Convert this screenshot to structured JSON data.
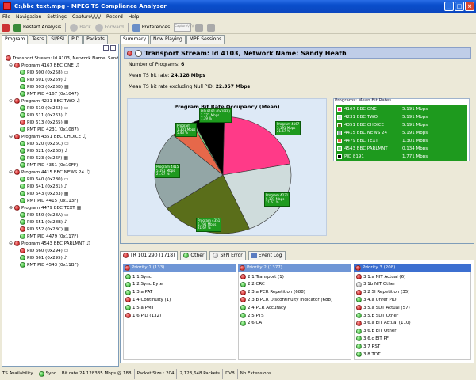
{
  "window": {
    "title": "C:\\bbc_text.mpg - MPEG TS Compliance Analyser"
  },
  "menu": [
    "File",
    "Navigation",
    "Settings",
    "Capture\\/\\/\\/",
    "Record",
    "Help"
  ],
  "toolbar": {
    "restart": "Restart Analysis",
    "back": "Back",
    "forward": "Forward",
    "preferences": "Preferences",
    "capture": "Capture\\/\\/\\/"
  },
  "left_tabs": [
    "Program",
    "Tests",
    "SI/PSI",
    "PID",
    "Packets"
  ],
  "tree": {
    "root": "Transport Stream: Id 4103, Network Name: Sand",
    "programs": [
      {
        "label": "Program 4167 BBC ONE",
        "pids": [
          "PID 600 (0x258)",
          "PID 601 (0x259)",
          "PID 603 (0x25B)",
          "PMT PID 4167 (0x1047)"
        ]
      },
      {
        "label": "Program 4231 BBC TWO",
        "pids": [
          "PID 610 (0x262)",
          "PID 611 (0x263)",
          "PID 613 (0x265)",
          "PMT PID 4231 (0x1087)"
        ]
      },
      {
        "label": "Program 4351 BBC CHOICE",
        "pids": [
          "PID 620 (0x26C)",
          "PID 621 (0x26D)",
          "PID 623 (0x26F)",
          "PMT PID 4351 (0x10FF)"
        ]
      },
      {
        "label": "Program 4415 BBC NEWS 24",
        "pids": [
          "PID 640 (0x280)",
          "PID 641 (0x281)",
          "PID 643 (0x283)",
          "PMT PID 4415 (0x113F)"
        ]
      },
      {
        "label": "Program 4479 BBC TEXT",
        "pids": [
          "PID 650 (0x28A)",
          "PID 651 (0x28B)",
          "PID 652 (0x28C)",
          "PMT PID 4479 (0x117F)"
        ]
      },
      {
        "label": "Program 4543 BBC PARLMNT",
        "pids": [
          "PID 660 (0x294)",
          "PID 661 (0x295)",
          "PMT PID 4543 (0x11BF)"
        ]
      }
    ]
  },
  "right_tabs": [
    "Summary",
    "Now Playing",
    "MPE Sessions"
  ],
  "summary": {
    "header": "Transport Stream: Id 4103, Network Name: Sandy Heath",
    "programs_label": "Number of Programs:",
    "programs_value": "6",
    "bitrate_label": "Mean TS bit rate:",
    "bitrate_value": "24.128 Mbps",
    "bitrate_null_label": "Mean TS bit rate excluding Null PID:",
    "bitrate_null_value": "22.357 Mbps"
  },
  "chart_data": {
    "type": "pie",
    "title": "Program Bit Rate Occupancy (Mean)",
    "legend_title": "Programs: Mean Bit Rates",
    "series": [
      {
        "name": "4167 BBC ONE",
        "value": 5.191,
        "label": "5.191 Mbps",
        "percent": "21.67 %",
        "color": "#ff3a88"
      },
      {
        "name": "4231 BBC TWO",
        "value": 5.191,
        "label": "5.191 Mbps",
        "percent": "21.67 %",
        "color": "#cfdcdc"
      },
      {
        "name": "4351 BBC CHOICE",
        "value": 5.191,
        "label": "5.191 Mbps",
        "percent": "21.67 %",
        "color": "#5a6e1a"
      },
      {
        "name": "4415 BBC NEWS 24",
        "value": 5.191,
        "label": "5.191 Mbps",
        "percent": "21.67 %",
        "color": "#93a6a6"
      },
      {
        "name": "4479 BBC TEXT",
        "value": 1.301,
        "label": "1.301 Mbps",
        "percent": "5.43 %",
        "color": "#e6684a"
      },
      {
        "name": "4543 BBC PARLMNT",
        "value": 0.134,
        "label": "0.134 Mbps",
        "percent": "",
        "color": "#7fcf7f"
      },
      {
        "name": "PID 8191",
        "value": 1.771,
        "label": "1.771 Mbps",
        "percent": "7.39 %",
        "color": "#000000"
      }
    ],
    "pie_labels": [
      "Program 4167\n5.191 Mbps\n21.67 %",
      "Program 4231\n5.191 Mbps\n21.67 %",
      "Program 4351\n5.191 Mbps\n21.67 %",
      "Program 4415\n5.191 Mbps\n21.67 %",
      "Program\n1.301 Mbps\n5.43 %",
      "PID 8191 (0x1FFF)\n1.771 Mbps\n7.39 %"
    ]
  },
  "bottom_tabs": [
    "TR 101 290 (1718)",
    "Other",
    "SFN Error",
    "Event Log"
  ],
  "priorities": [
    {
      "header": "Priority 1 (133)",
      "items": [
        {
          "text": "1.1 Sync",
          "status": "green"
        },
        {
          "text": "1.2 Sync Byte",
          "status": "green"
        },
        {
          "text": "1.3 a PAT",
          "status": "green"
        },
        {
          "text": "1.4 Continuity (1)",
          "status": "red"
        },
        {
          "text": "1.5 a PMT",
          "status": "green"
        },
        {
          "text": "1.6 PID (132)",
          "status": "red"
        }
      ]
    },
    {
      "header": "Priority 2 (1377)",
      "items": [
        {
          "text": "2.1 Transport (1)",
          "status": "red"
        },
        {
          "text": "2.2 CRC",
          "status": "green"
        },
        {
          "text": "2.3.a PCR Repetition (688)",
          "status": "red"
        },
        {
          "text": "2.3.b PCR Discontinuity Indicator (688)",
          "status": "red"
        },
        {
          "text": "2.4 PCR Accuracy",
          "status": "green"
        },
        {
          "text": "2.5 PTS",
          "status": "green"
        },
        {
          "text": "2.6 CAT",
          "status": "green"
        }
      ]
    },
    {
      "header": "Priority 3 (208)",
      "items": [
        {
          "text": "3.1.a NIT Actual (6)",
          "status": "red"
        },
        {
          "text": "3.1b NIT Other",
          "status": "gray"
        },
        {
          "text": "3.2 SI Repetition (35)",
          "status": "red"
        },
        {
          "text": "3.4.a Unref PID",
          "status": "green"
        },
        {
          "text": "3.5.a SDT Actual (57)",
          "status": "red"
        },
        {
          "text": "3.5.b SDT Other",
          "status": "green"
        },
        {
          "text": "3.6.a EIT Actual (110)",
          "status": "red"
        },
        {
          "text": "3.6.b EIT Other",
          "status": "green"
        },
        {
          "text": "3.6.c EIT PF",
          "status": "green"
        },
        {
          "text": "3.7 RST",
          "status": "green"
        },
        {
          "text": "3.8 TDT",
          "status": "green"
        }
      ]
    }
  ],
  "statusbar": {
    "ts_availability": "TS Availability",
    "sync": "Sync",
    "bitrate": "Bit rate  24.128335 Mbps @ 188",
    "packet_size": "Packet Size : 204",
    "packets": "2,123,648 Packets",
    "dvb": "DVB",
    "extensions": "No Extensions"
  }
}
